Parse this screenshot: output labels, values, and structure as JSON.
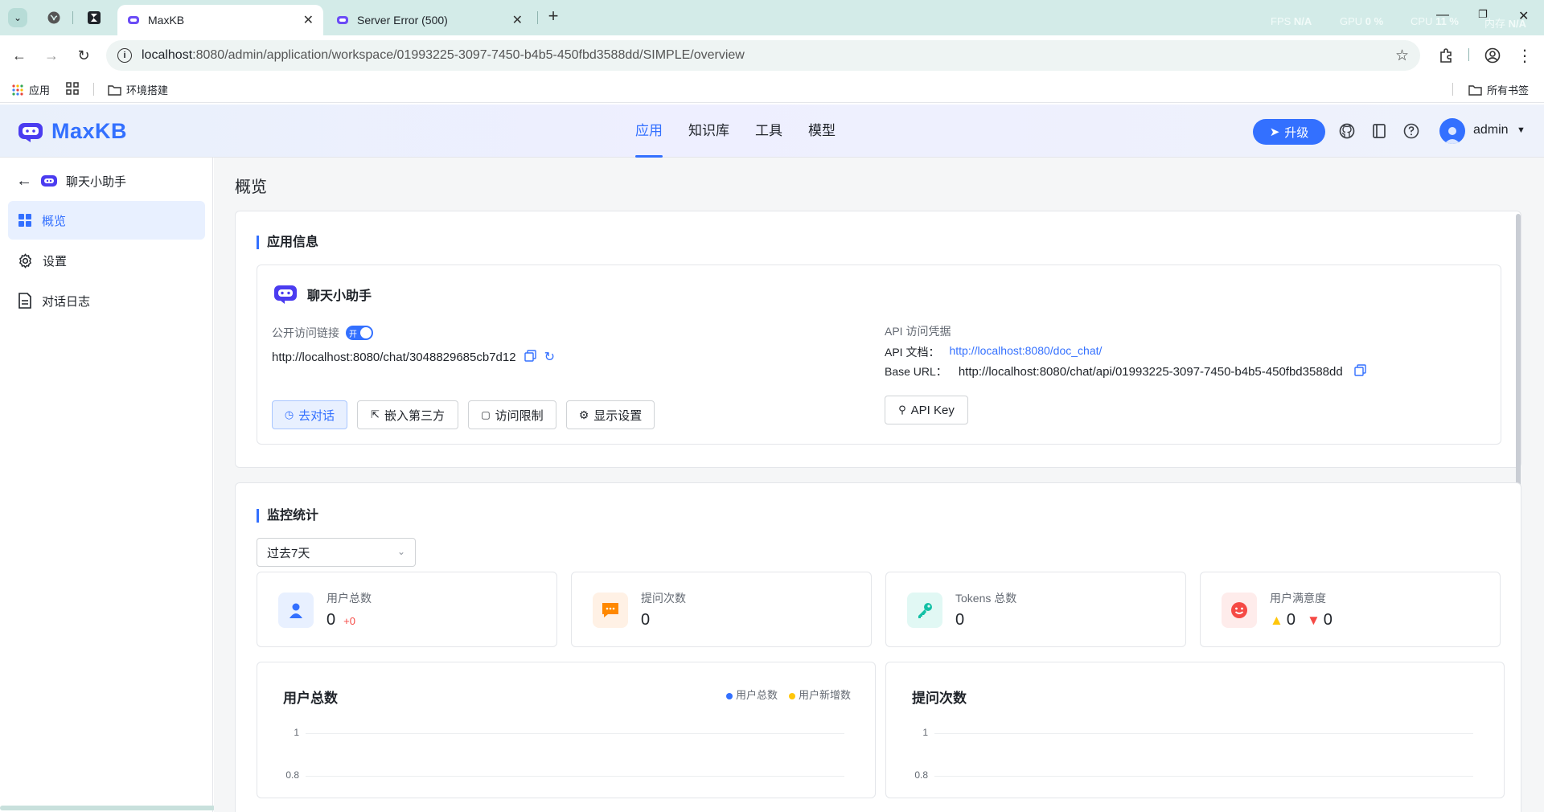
{
  "browser": {
    "tabs": [
      {
        "title": "MaxKB",
        "active": true
      },
      {
        "title": "Server Error (500)",
        "active": false
      }
    ],
    "perf": {
      "fps_label": "FPS",
      "fps_value": "N/A",
      "gpu_label": "GPU",
      "gpu_value": "0 %",
      "cpu_label": "CPU",
      "cpu_value": "11 %",
      "mem_label": "内存",
      "mem_value": "N/A"
    },
    "url_host": "localhost",
    "url_rest": ":8080/admin/application/workspace/01993225-3097-7450-b4b5-450fbd3588dd/SIMPLE/overview",
    "bookmarks": {
      "apps": "应用",
      "env": "环境搭建",
      "all": "所有书签"
    }
  },
  "header": {
    "logo": "MaxKB",
    "nav": [
      "应用",
      "知识库",
      "工具",
      "模型"
    ],
    "upgrade": "升级",
    "user": "admin"
  },
  "sidebar": {
    "app_name": "聊天小助手",
    "items": [
      "概览",
      "设置",
      "对话日志"
    ]
  },
  "main": {
    "page_title": "概览",
    "app_info": {
      "section_title": "应用信息",
      "name": "聊天小助手",
      "public_link_label": "公开访问链接",
      "switch_text": "开",
      "public_link": "http://localhost:8080/chat/3048829685cb7d12",
      "buttons": [
        "去对话",
        "嵌入第三方",
        "访问限制",
        "显示设置"
      ],
      "api_title": "API 访问凭据",
      "api_doc_label": "API 文档：",
      "api_doc_link": "http://localhost:8080/doc_chat/",
      "base_url_label": "Base URL：",
      "base_url": "http://localhost:8080/chat/api/01993225-3097-7450-b4b5-450fbd3588dd",
      "api_key_button": "API Key"
    },
    "monitor": {
      "section_title": "监控统计",
      "range": "过去7天",
      "stats": [
        {
          "label": "用户总数",
          "value": "0",
          "delta": "+0"
        },
        {
          "label": "提问次数",
          "value": "0"
        },
        {
          "label": "Tokens 总数",
          "value": "0"
        },
        {
          "label": "用户满意度",
          "like": "0",
          "dislike": "0"
        }
      ]
    }
  },
  "chart_data": [
    {
      "type": "line",
      "title": "用户总数",
      "series": [
        {
          "name": "用户总数",
          "color": "#3370ff"
        },
        {
          "name": "用户新增数",
          "color": "#ffc60a"
        }
      ],
      "yticks": [
        "1",
        "0.8"
      ]
    },
    {
      "type": "line",
      "title": "提问次数",
      "yticks": [
        "1",
        "0.8"
      ]
    }
  ],
  "colors": {
    "accent": "#3370ff",
    "danger": "#f54a45",
    "warning": "#ff8800",
    "teal": "#14c0a5"
  }
}
